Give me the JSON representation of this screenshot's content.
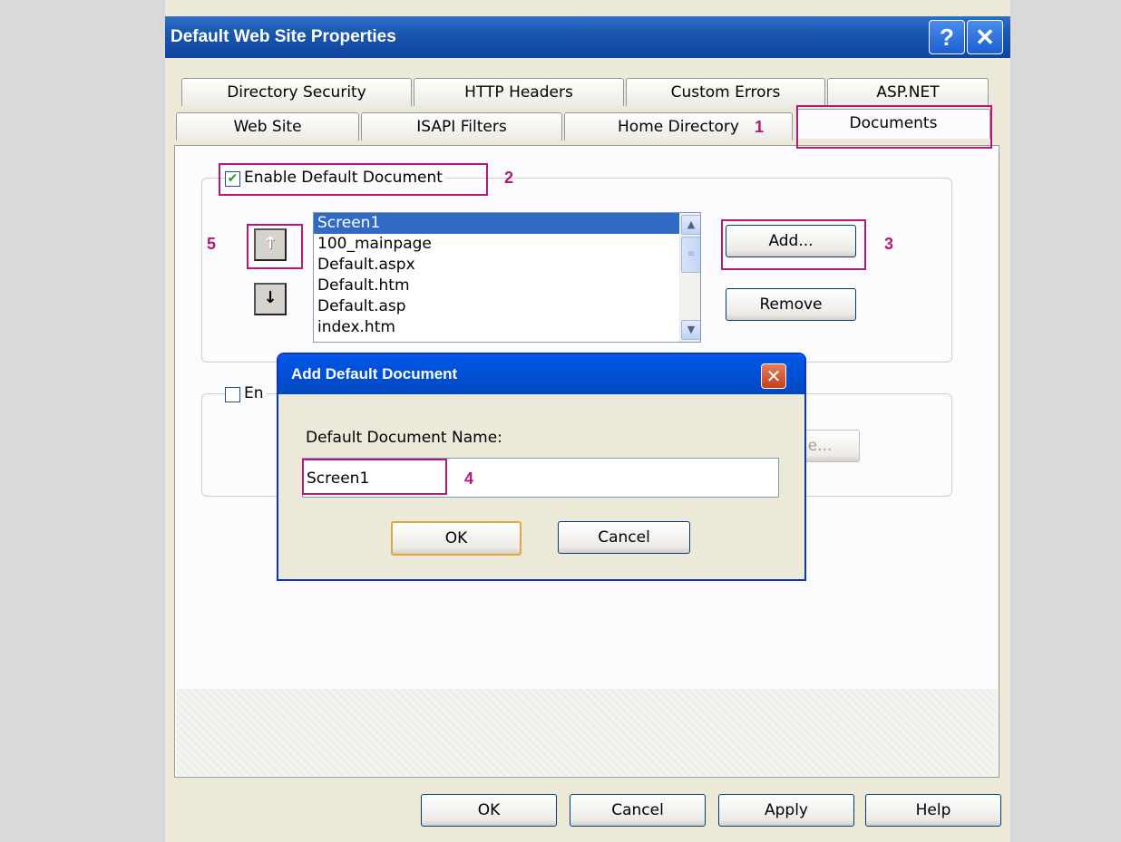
{
  "window": {
    "title": "Default Web Site Properties",
    "help_icon": "?",
    "close_icon": "✕"
  },
  "tabs": {
    "row1": [
      "Directory Security",
      "HTTP Headers",
      "Custom Errors",
      "ASP.NET"
    ],
    "row2": [
      "Web Site",
      "ISAPI Filters",
      "Home Directory",
      "Documents"
    ],
    "active": "Documents"
  },
  "default_document": {
    "checkbox_label": "Enable Default Document",
    "checked": true,
    "list": [
      "Screen1",
      "100_mainpage",
      "Default.aspx",
      "Default.htm",
      "Default.asp",
      "index.htm"
    ],
    "selected_index": 0,
    "move_up_icon": "↑",
    "move_down_icon": "↓",
    "add_label": "Add...",
    "remove_label": "Remove"
  },
  "footer_section": {
    "checkbox_label_partial": "En",
    "checked": false,
    "browse_partial": "e..."
  },
  "dialog": {
    "title": "Add Default Document",
    "field_label": "Default Document Name:",
    "field_value": "Screen1",
    "ok_label": "OK",
    "cancel_label": "Cancel",
    "close_icon": "✕"
  },
  "bottom_buttons": {
    "ok": "OK",
    "cancel": "Cancel",
    "apply": "Apply",
    "help": "Help"
  },
  "annotations": {
    "n1": "1",
    "n2": "2",
    "n3": "3",
    "n4": "4",
    "n5": "5",
    "color": "#b3187a"
  }
}
